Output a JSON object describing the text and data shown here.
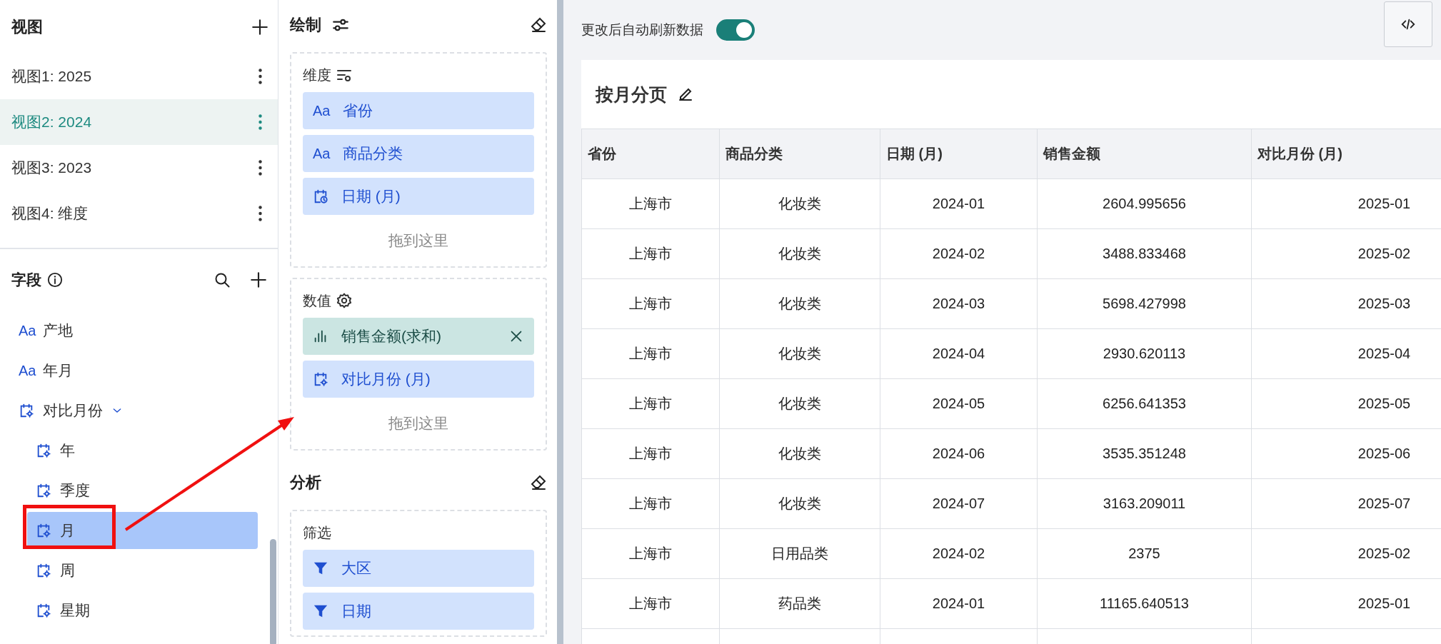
{
  "views": {
    "title": "视图",
    "items": [
      {
        "label": "视图1: 2025",
        "selected": false
      },
      {
        "label": "视图2: 2024",
        "selected": true
      },
      {
        "label": "视图3: 2023",
        "selected": false
      },
      {
        "label": "视图4: 维度",
        "selected": false
      }
    ]
  },
  "fields": {
    "title": "字段",
    "items": [
      {
        "kind": "text",
        "icon": "Aa",
        "label": "产地",
        "selected": false
      },
      {
        "kind": "text",
        "icon": "Aa",
        "label": "年月",
        "selected": false
      },
      {
        "kind": "derived",
        "label": "对比月份",
        "selected": false,
        "expanded": true,
        "children": [
          {
            "kind": "derived",
            "label": "年",
            "selected": false
          },
          {
            "kind": "derived",
            "label": "季度",
            "selected": false
          },
          {
            "kind": "derived",
            "label": "月",
            "selected": true
          },
          {
            "kind": "derived",
            "label": "周",
            "selected": false
          },
          {
            "kind": "derived",
            "label": "星期",
            "selected": false
          }
        ]
      }
    ]
  },
  "drawing": {
    "title": "绘制",
    "sections": [
      {
        "title": "维度",
        "pills": [
          {
            "kind": "text",
            "icon": "Aa",
            "label": "省份"
          },
          {
            "kind": "text",
            "icon": "Aa",
            "label": "商品分类"
          },
          {
            "kind": "date",
            "label": "日期 (月)"
          }
        ],
        "drop_hint": "拖到这里"
      },
      {
        "title": "数值",
        "pills": [
          {
            "kind": "measure",
            "label": "销售金额(求和)"
          },
          {
            "kind": "derived",
            "label": "对比月份 (月)"
          }
        ],
        "drop_hint": "拖到这里"
      }
    ]
  },
  "analysis": {
    "title": "分析",
    "sections": [
      {
        "title": "筛选",
        "pills": [
          {
            "kind": "filter",
            "label": "大区"
          },
          {
            "kind": "filter",
            "label": "日期"
          }
        ]
      }
    ]
  },
  "auto_refresh": {
    "label": "更改后自动刷新数据",
    "on": true
  },
  "report": {
    "title": "按月分页",
    "table": {
      "columns": [
        "省份",
        "商品分类",
        "日期 (月)",
        "销售金额",
        "对比月份 (月)"
      ],
      "rows": [
        [
          "上海市",
          "化妆类",
          "2024-01",
          "2604.995656",
          "2025-01"
        ],
        [
          "上海市",
          "化妆类",
          "2024-02",
          "3488.833468",
          "2025-02"
        ],
        [
          "上海市",
          "化妆类",
          "2024-03",
          "5698.427998",
          "2025-03"
        ],
        [
          "上海市",
          "化妆类",
          "2024-04",
          "2930.620113",
          "2025-04"
        ],
        [
          "上海市",
          "化妆类",
          "2024-05",
          "6256.641353",
          "2025-05"
        ],
        [
          "上海市",
          "化妆类",
          "2024-06",
          "3535.351248",
          "2025-06"
        ],
        [
          "上海市",
          "化妆类",
          "2024-07",
          "3163.209011",
          "2025-07"
        ],
        [
          "上海市",
          "日用品类",
          "2024-02",
          "2375",
          "2025-02"
        ],
        [
          "上海市",
          "药品类",
          "2024-01",
          "11165.640513",
          "2025-01"
        ]
      ]
    }
  }
}
